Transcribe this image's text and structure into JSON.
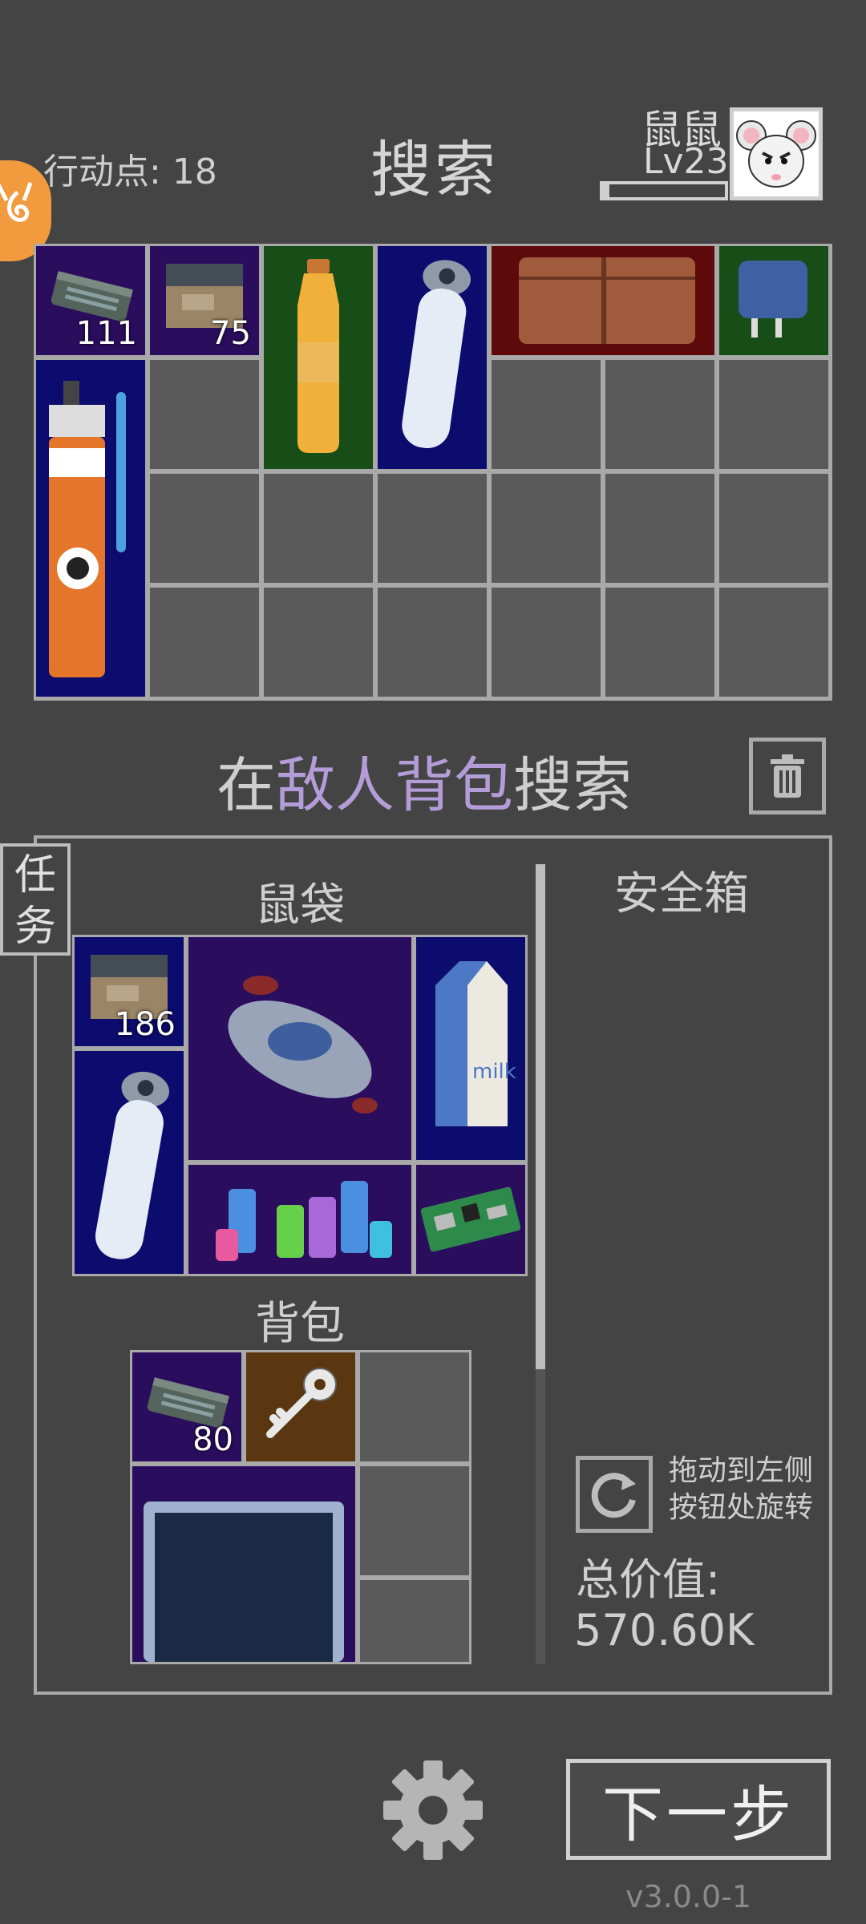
{
  "header": {
    "action_points_label": "行动点:",
    "action_points_value": "18",
    "title": "搜索",
    "player_name": "鼠鼠",
    "player_level": "Lv23"
  },
  "loot": {
    "items": [
      {
        "name": "battery",
        "qty": "111"
      },
      {
        "name": "cardboard-box",
        "qty": "75"
      },
      {
        "name": "oil-bottle"
      },
      {
        "name": "water-bottle"
      },
      {
        "name": "leather-wallet"
      },
      {
        "name": "power-adapter"
      },
      {
        "name": "spray-can-and-pen"
      }
    ]
  },
  "search_section": {
    "prefix": "在",
    "highlight": "敌人背包",
    "suffix": "搜索"
  },
  "task_tab": {
    "line1": "任",
    "line2": "务"
  },
  "rat_bag": {
    "label": "鼠袋",
    "items": [
      {
        "name": "cardboard-box",
        "qty": "186"
      },
      {
        "name": "spaceship"
      },
      {
        "name": "milk-carton",
        "text": "milk"
      },
      {
        "name": "water-bottle"
      },
      {
        "name": "chemical-bottles"
      },
      {
        "name": "circuit-board"
      }
    ]
  },
  "backpack": {
    "label": "背包",
    "items": [
      {
        "name": "battery",
        "qty": "80"
      },
      {
        "name": "key"
      },
      {
        "name": "monitor"
      }
    ]
  },
  "safe_box": {
    "label": "安全箱"
  },
  "rotate_hint": {
    "line1": "拖动到左侧",
    "line2": "按钮处旋转"
  },
  "total": {
    "label": "总价值:",
    "value": "570.60K"
  },
  "next_button": {
    "label": "下一步"
  },
  "version": "v3.0.0-1",
  "colors": {
    "background": "#444444",
    "highlight": "#b49cd8",
    "badge": "#f19a3e"
  },
  "xp_progress": 0.05
}
